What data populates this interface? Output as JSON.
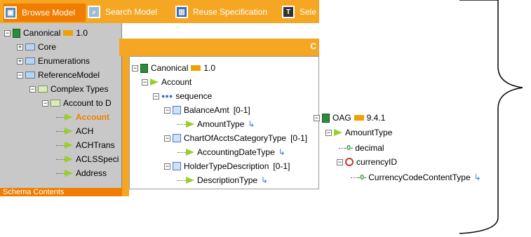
{
  "tabs": [
    {
      "label": "Browse Model",
      "icon": "browse-icon"
    },
    {
      "label": "Search Model",
      "icon": "search-icon"
    },
    {
      "label": "Reuse Specification",
      "icon": "reuse-icon"
    },
    {
      "label": "Sele",
      "icon": "text-icon"
    }
  ],
  "left_tree": {
    "root": "Canonical",
    "root_version": "1.0",
    "items": [
      "Core",
      "Enumerations",
      "ReferenceModel",
      "Complex Types",
      "Account to D",
      "Account",
      "ACH",
      "ACHTrans",
      "ACLSSpeci",
      "Address"
    ]
  },
  "schema_label": "Schema Contents",
  "popup_tree": {
    "root": "Canonical",
    "root_version": "1.0",
    "account": "Account",
    "sequence": "sequence",
    "balance": "BalanceAmt",
    "balance_card": "[0-1]",
    "amount_type": "AmountType",
    "chart": "ChartOfAcctsCategoryType",
    "chart_card": "[0-1]",
    "accounting_date": "AccountingDateType",
    "holder": "HolderTypeDescription",
    "holder_card": "[0-1]",
    "description": "DescriptionType"
  },
  "oag_tree": {
    "root": "OAG",
    "root_version": "9.4.1",
    "amount_type": "AmountType",
    "decimal": "decimal",
    "currency_id": "currencyID",
    "currency_code": "CurrencyCodeContentType"
  },
  "orange_header_tail": "C"
}
